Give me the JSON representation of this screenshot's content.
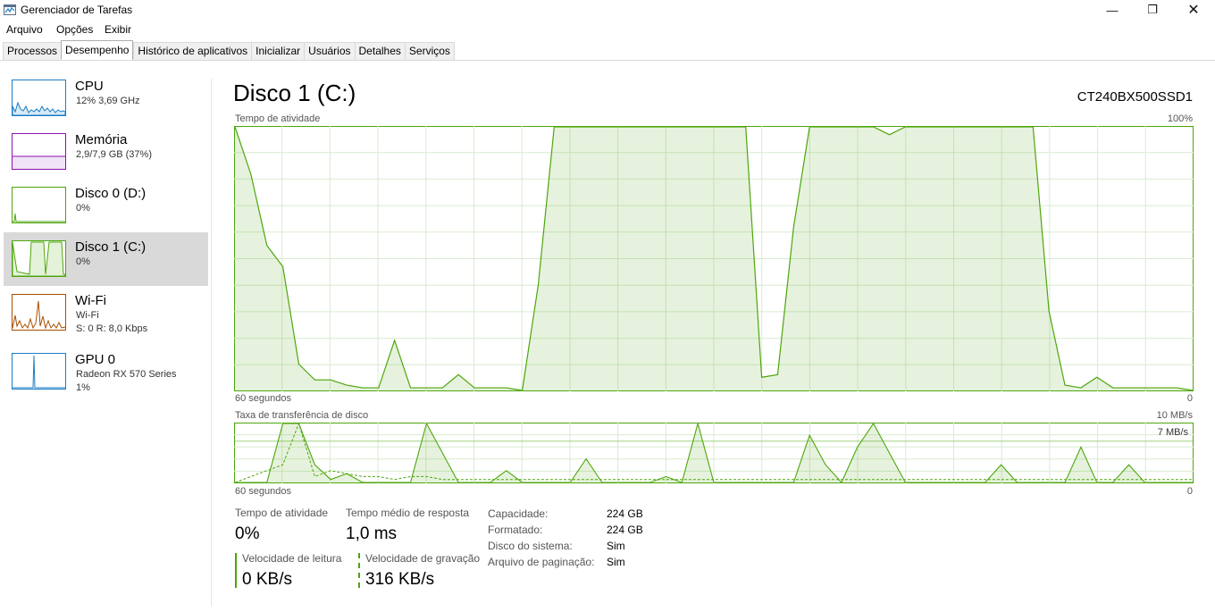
{
  "window": {
    "title": "Gerenciador de Tarefas",
    "icon": "task-manager-icon"
  },
  "window_controls": {
    "minimize": "—",
    "maximize": "❐",
    "close": "✕"
  },
  "menu": [
    "Arquivo",
    "Opções",
    "Exibir"
  ],
  "tabs": [
    "Processos",
    "Desempenho",
    "Histórico de aplicativos",
    "Inicializar",
    "Usuários",
    "Detalhes",
    "Serviços"
  ],
  "active_tab": "Desempenho",
  "sidebar": [
    {
      "name": "CPU",
      "line1": "12% 3,69 GHz",
      "line2": "",
      "color": "#1a7dc4"
    },
    {
      "name": "Memória",
      "line1": "2,9/7,9 GB (37%)",
      "line2": "",
      "color": "#8b12ae"
    },
    {
      "name": "Disco 0 (D:)",
      "line1": "0%",
      "line2": "",
      "color": "#4da60c"
    },
    {
      "name": "Disco 1 (C:)",
      "line1": "0%",
      "line2": "",
      "color": "#4da60c"
    },
    {
      "name": "Wi-Fi",
      "line1": "Wi-Fi",
      "line2": "S: 0 R: 8,0 Kbps",
      "color": "#a74f01"
    },
    {
      "name": "GPU 0",
      "line1": "Radeon RX 570 Series",
      "line2": "1%",
      "color": "#1a7dc4"
    }
  ],
  "selected_sidebar": "Disco 1 (C:)",
  "main": {
    "title": "Disco 1 (C:)",
    "device": "CT240BX500SSD1",
    "graph1": {
      "label": "Tempo de atividade",
      "max": "100%",
      "bottom_left": "60 segundos",
      "bottom_right": "0"
    },
    "graph2": {
      "label": "Taxa de transferência de disco",
      "max": "10 MB/s",
      "secondary_max": "7 MB/s",
      "bottom_left": "60 segundos",
      "bottom_right": "0"
    }
  },
  "stats": {
    "active_time": {
      "label": "Tempo de atividade",
      "value": "0%"
    },
    "response_time": {
      "label": "Tempo médio de resposta",
      "value": "1,0 ms"
    },
    "read_speed": {
      "label": "Velocidade de leitura",
      "value": "0 KB/s"
    },
    "write_speed": {
      "label": "Velocidade de gravação",
      "value": "316 KB/s"
    }
  },
  "properties": [
    {
      "key": "Capacidade:",
      "value": "224 GB"
    },
    {
      "key": "Formatado:",
      "value": "224 GB"
    },
    {
      "key": "Disco do sistema:",
      "value": "Sim"
    },
    {
      "key": "Arquivo de paginação:",
      "value": "Sim"
    }
  ],
  "chart_data": [
    {
      "type": "area",
      "title": "Tempo de atividade",
      "xlabel": "60 segundos",
      "ylim": [
        0,
        100
      ],
      "x": [
        60,
        59,
        58,
        57,
        56,
        55,
        54,
        53,
        52,
        51,
        50,
        49,
        48,
        47,
        46,
        45,
        44,
        43,
        42,
        41,
        40,
        39,
        38,
        37,
        36,
        35,
        34,
        33,
        32,
        31,
        30,
        29,
        28,
        27,
        26,
        25,
        24,
        23,
        22,
        21,
        20,
        19,
        18,
        17,
        16,
        15,
        14,
        13,
        12,
        11,
        10,
        9,
        8,
        7,
        6,
        5,
        4,
        3,
        2,
        1,
        0
      ],
      "series": [
        {
          "values": [
            100,
            82,
            55,
            47,
            10,
            4,
            4,
            2,
            1,
            1,
            19,
            1,
            1,
            1,
            6,
            1,
            1,
            1,
            0,
            40,
            100,
            100,
            100,
            100,
            100,
            100,
            100,
            100,
            100,
            100,
            100,
            100,
            100,
            5,
            6,
            62,
            100,
            100,
            100,
            100,
            100,
            97,
            100,
            100,
            100,
            100,
            100,
            100,
            100,
            100,
            100,
            30,
            2,
            1,
            5,
            1,
            1,
            1,
            1,
            1,
            0
          ]
        }
      ]
    },
    {
      "type": "line",
      "title": "Taxa de transferência de disco",
      "xlabel": "60 segundos",
      "ylim": [
        0,
        10
      ],
      "x": [
        60,
        59,
        58,
        57,
        56,
        55,
        54,
        53,
        52,
        51,
        50,
        49,
        48,
        47,
        46,
        45,
        44,
        43,
        42,
        41,
        40,
        39,
        38,
        37,
        36,
        35,
        34,
        33,
        32,
        31,
        30,
        29,
        28,
        27,
        26,
        25,
        24,
        23,
        22,
        21,
        20,
        19,
        18,
        17,
        16,
        15,
        14,
        13,
        12,
        11,
        10,
        9,
        8,
        7,
        6,
        5,
        4,
        3,
        2,
        1,
        0
      ],
      "series": [
        {
          "values": [
            0,
            0,
            0,
            10,
            10,
            3,
            0.5,
            1.5,
            0,
            0,
            0,
            0,
            10,
            5,
            0,
            0,
            0,
            2,
            0,
            0,
            0,
            0,
            4,
            0,
            0,
            0,
            0,
            1,
            0,
            10,
            0,
            0,
            0,
            0,
            0,
            0,
            8,
            3,
            0,
            6,
            10,
            5,
            0,
            0,
            0,
            0,
            0,
            0,
            3,
            0,
            0,
            0,
            0,
            6,
            0,
            0,
            3,
            0,
            0,
            0,
            0
          ]
        },
        {
          "values": [
            0,
            1,
            2,
            3,
            10,
            1,
            2,
            1.5,
            1,
            1,
            0.5,
            1,
            1,
            0.5,
            0.5,
            0.5,
            0.5,
            0.5,
            0.5,
            0.5,
            0.5,
            0.5,
            0.5,
            0.5,
            0.5,
            0.5,
            0.5,
            0.5,
            0.5,
            0.5,
            0.5,
            0.5,
            0.5,
            0.5,
            0.5,
            0.5,
            0.5,
            0.5,
            0.5,
            0.5,
            0.5,
            0.5,
            0.5,
            0.5,
            0.5,
            0.5,
            0.5,
            0.5,
            0.5,
            0.5,
            0.5,
            0.5,
            0.5,
            0.5,
            0.5,
            0.5,
            0.5,
            0.5,
            0.5,
            0.5,
            0.5
          ]
        }
      ]
    }
  ]
}
